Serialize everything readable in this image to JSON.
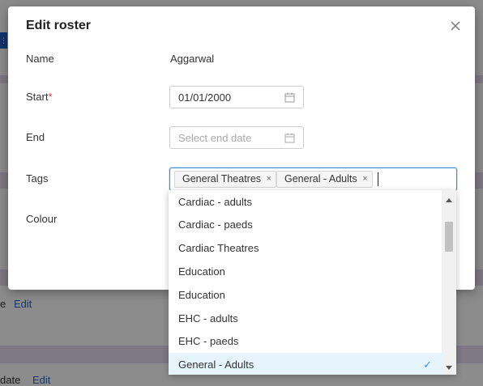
{
  "background": {
    "row1_text": "e",
    "row1_link": "Edit",
    "row2_text": "date",
    "row2_link": "Edit"
  },
  "modal": {
    "title": "Edit roster",
    "close_icon": "close-icon",
    "fields": {
      "name_label": "Name",
      "name_value": "Aggarwal",
      "start_label": "Start",
      "start_required_marker": "*",
      "start_value": "01/01/2000",
      "end_label": "End",
      "end_placeholder": "Select end date",
      "tags_label": "Tags",
      "colour_label": "Colour"
    },
    "tags": [
      {
        "label": "General Theatres",
        "remove": "×"
      },
      {
        "label": "General - Adults",
        "remove": "×"
      }
    ]
  },
  "dropdown": {
    "options": [
      {
        "label": "Cardiac - adults"
      },
      {
        "label": "Cardiac - paeds"
      },
      {
        "label": "Cardiac Theatres"
      },
      {
        "label": "Education"
      },
      {
        "label": "Education"
      },
      {
        "label": "EHC - adults"
      },
      {
        "label": "EHC - paeds"
      },
      {
        "label": "General - Adults",
        "selected": true,
        "check": "✓"
      }
    ]
  },
  "colors": {
    "accent": "#3d8fd6",
    "selected_bg": "#e6f4fc",
    "required": "#e0303a",
    "link": "#2a66c8"
  }
}
